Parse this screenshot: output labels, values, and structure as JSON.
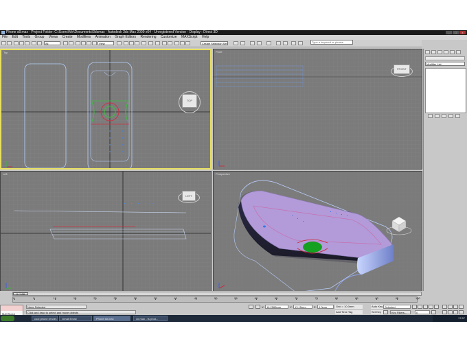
{
  "window": {
    "title": "Phone s8.max  - Project Folder: C:\\Users\\Me\\Documents\\3dsmax  - Autodesk 3ds Max 2009 x64  - Unregistered Version  - Display : Direct 3D"
  },
  "menu": [
    "File",
    "Edit",
    "Tools",
    "Group",
    "Views",
    "Create",
    "Modifiers",
    "Animation",
    "Graph Editors",
    "Rendering",
    "Customize",
    "MAXScript",
    "Help"
  ],
  "toolbar": {
    "filter_value": "All",
    "refcoord_value": "View",
    "selection_set_placeholder": "Create Selection Set",
    "search_placeholder": "Type a keyword or phrase"
  },
  "viewports": {
    "top": "Top",
    "front": "Front",
    "left": "Left",
    "perspective": "Perspective"
  },
  "viewcube": {
    "top": "TOP",
    "front": "FRONT",
    "left": "LEFT"
  },
  "command_panel": {
    "modifier_list": "Modifier List"
  },
  "timeslider": {
    "frame": "0 / 100"
  },
  "trackbar": {
    "ticks": [
      "0",
      "5",
      "10",
      "15",
      "20",
      "25",
      "30",
      "35",
      "40",
      "45",
      "50",
      "55",
      "60",
      "65",
      "70",
      "75",
      "80",
      "85",
      "90",
      "95",
      "100"
    ]
  },
  "status": {
    "maxscript": "MAXScript",
    "selection": "None Selected",
    "prompt": "Click and drag to select and move objects",
    "x_value": "16.2568mm",
    "y_value": "13.15mm",
    "z_value": "0.0mm",
    "grid": "Grid = 10.0mm",
    "add_time_tag": "Add Time Tag",
    "auto_key": "Auto Key",
    "set_key": "Set Key",
    "selected_value": "Selected",
    "key_filters": "Key Filters...",
    "current_frame": "0"
  },
  "taskbar": {
    "items": [
      "cool phone render...",
      "Gmail Email",
      "Phone s8.max",
      "3d max - ts prod..."
    ],
    "clock": "17:57"
  },
  "colors": {
    "viewport_bg": "#7b7b7b",
    "active_border": "#e8e060",
    "phone_body": "#b29bd8",
    "button_green": "#14a020",
    "button_red": "#cc2233"
  }
}
